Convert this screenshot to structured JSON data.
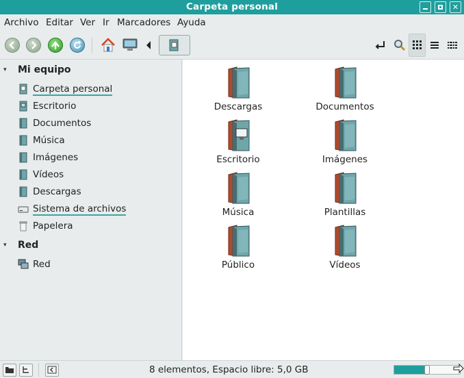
{
  "window": {
    "title": "Carpeta personal"
  },
  "menubar": [
    "Archivo",
    "Editar",
    "Ver",
    "Ir",
    "Marcadores",
    "Ayuda"
  ],
  "toolbar": {
    "buttons": [
      "back-icon",
      "forward-icon",
      "up-icon",
      "reload-icon",
      "home-icon",
      "computer-icon"
    ],
    "view_buttons": [
      "path-icon",
      "search-icon",
      "icon-view-icon",
      "list-view-icon",
      "compact-view-icon"
    ]
  },
  "sidebar": {
    "sections": [
      {
        "title": "Mi equipo",
        "items": [
          {
            "label": "Carpeta personal",
            "icon": "home-folder-icon"
          },
          {
            "label": "Escritorio",
            "icon": "desktop-folder-icon"
          },
          {
            "label": "Documentos",
            "icon": "folder-icon"
          },
          {
            "label": "Música",
            "icon": "folder-icon"
          },
          {
            "label": "Imágenes",
            "icon": "folder-icon"
          },
          {
            "label": "Vídeos",
            "icon": "folder-icon"
          },
          {
            "label": "Descargas",
            "icon": "folder-icon"
          },
          {
            "label": "Sistema de archivos",
            "icon": "drive-icon"
          },
          {
            "label": "Papelera",
            "icon": "trash-icon"
          }
        ]
      },
      {
        "title": "Red",
        "items": [
          {
            "label": "Red",
            "icon": "network-icon"
          }
        ]
      }
    ]
  },
  "files": [
    {
      "name": "Descargas",
      "icon": "folder-icon"
    },
    {
      "name": "Documentos",
      "icon": "folder-icon"
    },
    {
      "name": "Escritorio",
      "icon": "desktop-folder-icon"
    },
    {
      "name": "Imágenes",
      "icon": "folder-icon"
    },
    {
      "name": "Música",
      "icon": "folder-icon"
    },
    {
      "name": "Plantillas",
      "icon": "folder-icon"
    },
    {
      "name": "Público",
      "icon": "folder-icon"
    },
    {
      "name": "Vídeos",
      "icon": "folder-icon"
    }
  ],
  "status": {
    "text": "8 elementos, Espacio libre: 5,0 GB",
    "zoom_level": 0.5
  },
  "colors": {
    "accent": "#1f9e9e",
    "sidebar_bg": "#e8ecec",
    "main_bg": "#ffffff"
  }
}
